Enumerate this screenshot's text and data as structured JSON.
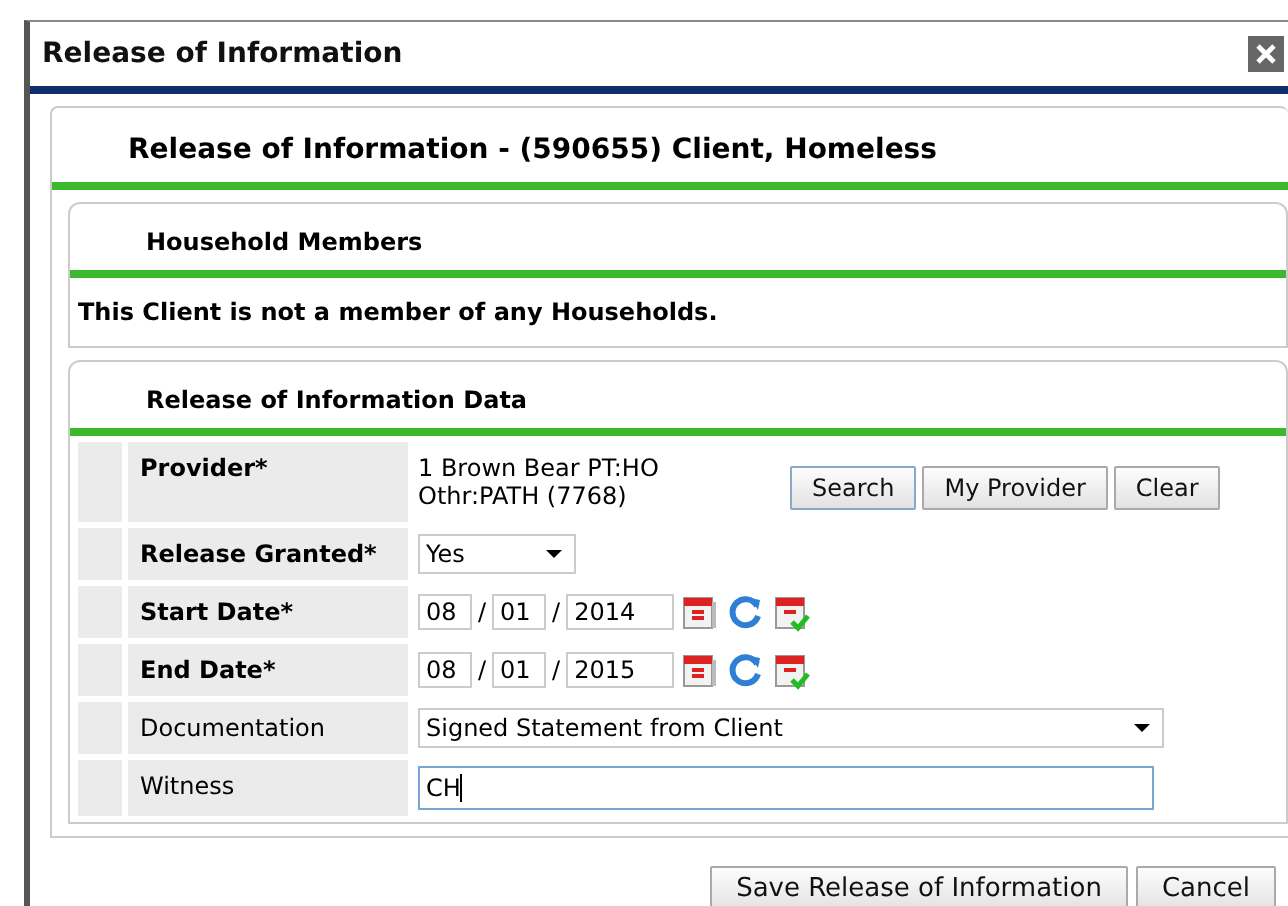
{
  "window": {
    "title": "Release of Information"
  },
  "header": {
    "title": "Release of Information - (590655) Client, Homeless"
  },
  "household": {
    "title": "Household Members",
    "message": "This Client is not a member of any Households."
  },
  "data_section": {
    "title": "Release of Information Data",
    "rows": [
      {
        "kind": "provider",
        "label": "Provider*",
        "required": true,
        "value_lines": [
          "1 Brown Bear PT:HO",
          "Othr:PATH (7768)"
        ],
        "buttons": [
          "Search",
          "My Provider",
          "Clear"
        ]
      },
      {
        "kind": "select",
        "label": "Release Granted*",
        "required": true,
        "value": "Yes"
      },
      {
        "kind": "date",
        "label": "Start Date*",
        "required": true,
        "month": "08",
        "day": "01",
        "year": "2014",
        "separators": [
          "/",
          "/"
        ]
      },
      {
        "kind": "date",
        "label": "End Date*",
        "required": true,
        "month": "08",
        "day": "01",
        "year": "2015",
        "separators": [
          "/",
          "/"
        ]
      },
      {
        "kind": "wide_select",
        "label": "Documentation",
        "required": false,
        "value": "Signed Statement from Client"
      },
      {
        "kind": "text",
        "label": "Witness",
        "required": false,
        "value": "CH",
        "focused": true
      }
    ]
  },
  "buttons": [
    "Save Release of Information",
    "Cancel"
  ]
}
